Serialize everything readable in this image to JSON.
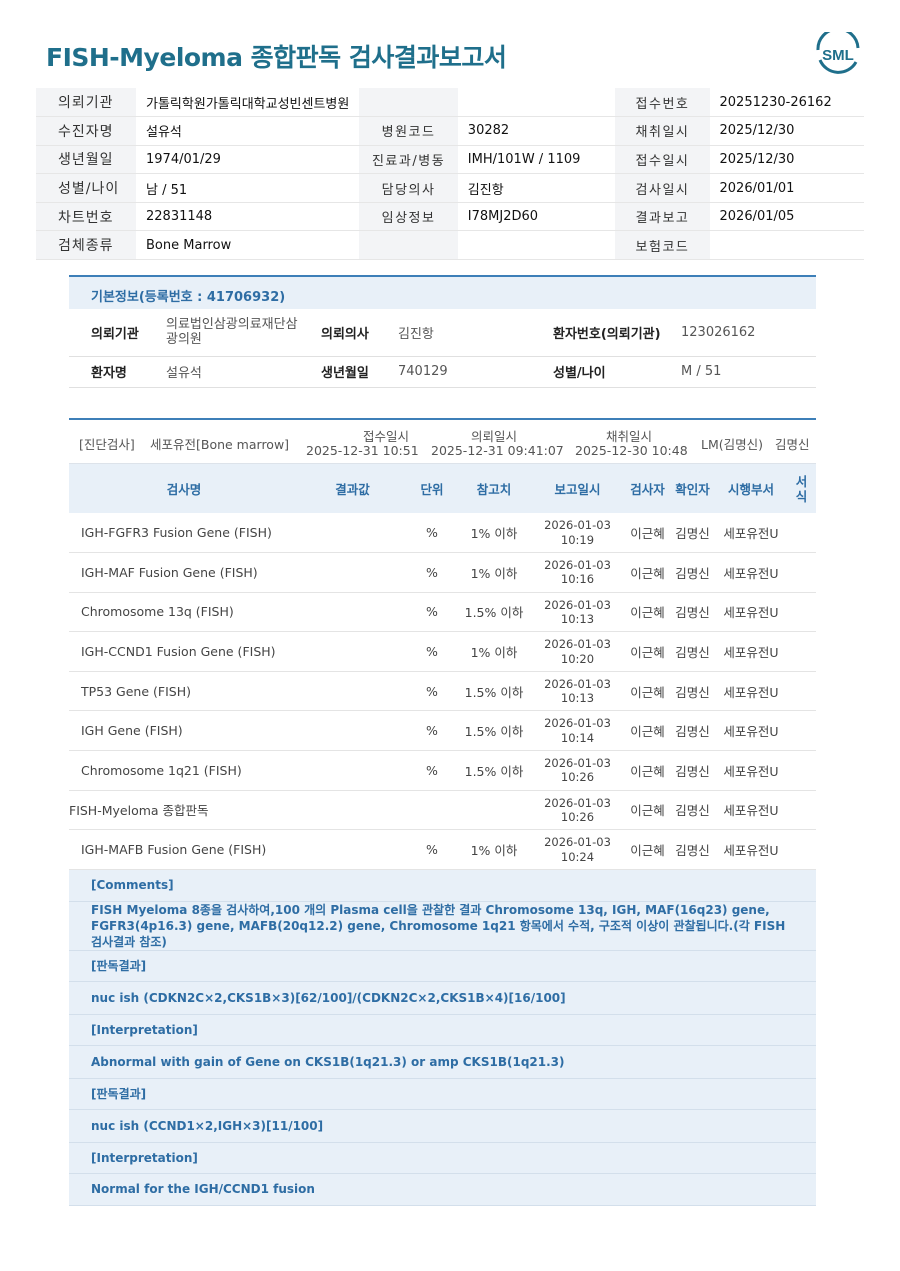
{
  "report_title": "FISH-Myeloma 종합판독 검사결과보고서",
  "logo_text": "SML",
  "header": {
    "rows": [
      {
        "l1": "의뢰기관",
        "v1": "가톨릭학원가톨릭대학교성빈센트병원",
        "l2": "",
        "v2": "",
        "l3": "접수번호",
        "v3": "20251230-26162"
      },
      {
        "l1": "수진자명",
        "v1": "설유석",
        "l2": "병원코드",
        "v2": "30282",
        "l3": "채취일시",
        "v3": "2025/12/30"
      },
      {
        "l1": "생년월일",
        "v1": "1974/01/29",
        "l2": "진료과/병동",
        "v2": "IMH/101W / 1109",
        "l3": "접수일시",
        "v3": "2025/12/30"
      },
      {
        "l1": "성별/나이",
        "v1": "남 / 51",
        "l2": "담당의사",
        "v2": "김진항",
        "l3": "검사일시",
        "v3": "2026/01/01"
      },
      {
        "l1": "차트번호",
        "v1": "22831148",
        "l2": "임상정보",
        "v2": "I78MJ2D60",
        "l3": "결과보고",
        "v3": "2026/01/05"
      },
      {
        "l1": "검체종류",
        "v1": "Bone Marrow",
        "l2": "",
        "v2": "",
        "l3": "보험코드",
        "v3": ""
      }
    ]
  },
  "basic": {
    "heading": "기본정보(등록번호 : 41706932)",
    "row1": {
      "a_label": "의뢰기관",
      "a_value_line1": "의료법인삼광의료재단삼",
      "a_value_line2": "광의원",
      "b_label": "의뢰의사",
      "b_value": "김진항",
      "c_label": "환자번호(의뢰기관)",
      "c_value": "123026162"
    },
    "row2": {
      "a_label": "환자명",
      "a_value": "설유석",
      "b_label": "생년월일",
      "b_value": "740129",
      "c_label": "성별/나이",
      "c_value": "M / 51"
    }
  },
  "results": {
    "info": {
      "category": "[진단검사]",
      "dept": "세포유전[Bone marrow]",
      "received_label": "접수일시",
      "received_value": "2025-12-31 10:51",
      "requested_label": "의뢰일시",
      "requested_value": "2025-12-31 09:41:07",
      "collected_label": "채취일시",
      "collected_value": "2025-12-30 10:48",
      "lm": "LM(김명신)",
      "doctor": "김명신"
    },
    "columns": {
      "name": "검사명",
      "result": "결과값",
      "unit": "단위",
      "ref": "참고치",
      "report_date": "보고일시",
      "tester": "검사자",
      "confirmer": "확인자",
      "dept": "시행부서",
      "form_1": "서",
      "form_2": "식"
    },
    "rows": [
      {
        "name": "IGH-FGFR3 Fusion Gene (FISH)",
        "result": "",
        "unit": "%",
        "ref": "1% 이하",
        "date": "2026-01-03",
        "time": "10:19",
        "tester": "이근혜",
        "confirmer": "김명신",
        "dept": "세포유전U"
      },
      {
        "name": "IGH-MAF Fusion Gene (FISH)",
        "result": "",
        "unit": "%",
        "ref": "1% 이하",
        "date": "2026-01-03",
        "time": "10:16",
        "tester": "이근혜",
        "confirmer": "김명신",
        "dept": "세포유전U"
      },
      {
        "name": "Chromosome 13q (FISH)",
        "result": "",
        "unit": "%",
        "ref": "1.5% 이하",
        "date": "2026-01-03",
        "time": "10:13",
        "tester": "이근혜",
        "confirmer": "김명신",
        "dept": "세포유전U"
      },
      {
        "name": "IGH-CCND1 Fusion Gene (FISH)",
        "result": "",
        "unit": "%",
        "ref": "1% 이하",
        "date": "2026-01-03",
        "time": "10:20",
        "tester": "이근혜",
        "confirmer": "김명신",
        "dept": "세포유전U"
      },
      {
        "name": "TP53 Gene (FISH)",
        "result": "",
        "unit": "%",
        "ref": "1.5% 이하",
        "date": "2026-01-03",
        "time": "10:13",
        "tester": "이근혜",
        "confirmer": "김명신",
        "dept": "세포유전U"
      },
      {
        "name": "IGH Gene (FISH)",
        "result": "",
        "unit": "%",
        "ref": "1.5% 이하",
        "date": "2026-01-03",
        "time": "10:14",
        "tester": "이근혜",
        "confirmer": "김명신",
        "dept": "세포유전U"
      },
      {
        "name": "Chromosome 1q21 (FISH)",
        "result": "",
        "unit": "%",
        "ref": "1.5% 이하",
        "date": "2026-01-03",
        "time": "10:26",
        "tester": "이근혜",
        "confirmer": "김명신",
        "dept": "세포유전U"
      },
      {
        "name": "FISH-Myeloma 종합판독",
        "result": "",
        "unit": "",
        "ref": "",
        "date": "2026-01-03",
        "time": "10:26",
        "tester": "이근혜",
        "confirmer": "김명신",
        "dept": "세포유전U",
        "nopad": true
      },
      {
        "name": "IGH-MAFB Fusion Gene (FISH)",
        "result": "",
        "unit": "%",
        "ref": "1% 이하",
        "date": "2026-01-03",
        "time": "10:24",
        "tester": "이근혜",
        "confirmer": "김명신",
        "dept": "세포유전U"
      }
    ]
  },
  "comments": [
    {
      "text": "[Comments]",
      "kind": "head"
    },
    {
      "text": "FISH Myeloma 8종을 검사하여,100 개의 Plasma cell을 관찰한 결과 Chromosome 13q, IGH, MAF(16q23) gene, FGFR3(4p16.3) gene, MAFB(20q12.2) gene, Chromosome 1q21 항목에서 수적, 구조적 이상이 관찰됩니다.(각 FISH검사결과 참조)",
      "kind": "body"
    },
    {
      "text": "[판독결과]",
      "kind": "head"
    },
    {
      "text": "nuc ish (CDKN2C×2,CKS1B×3)[62/100]/(CDKN2C×2,CKS1B×4)[16/100]",
      "kind": "body"
    },
    {
      "text": "[Interpretation]",
      "kind": "head"
    },
    {
      "text": "Abnormal with gain of Gene on CKS1B(1q21.3) or amp CKS1B(1q21.3)",
      "kind": "body"
    },
    {
      "text": "[판독결과]",
      "kind": "head"
    },
    {
      "text": "nuc ish (CCND1×2,IGH×3)[11/100]",
      "kind": "body"
    },
    {
      "text": "[Interpretation]",
      "kind": "head"
    },
    {
      "text": "Normal for the IGH/CCND1 fusion",
      "kind": "body"
    }
  ],
  "colors": {
    "title": "#1f6f8b",
    "accent": "#2e6da4",
    "header_bg": "#e8f0f8",
    "label_bg": "#f3f4f6"
  }
}
